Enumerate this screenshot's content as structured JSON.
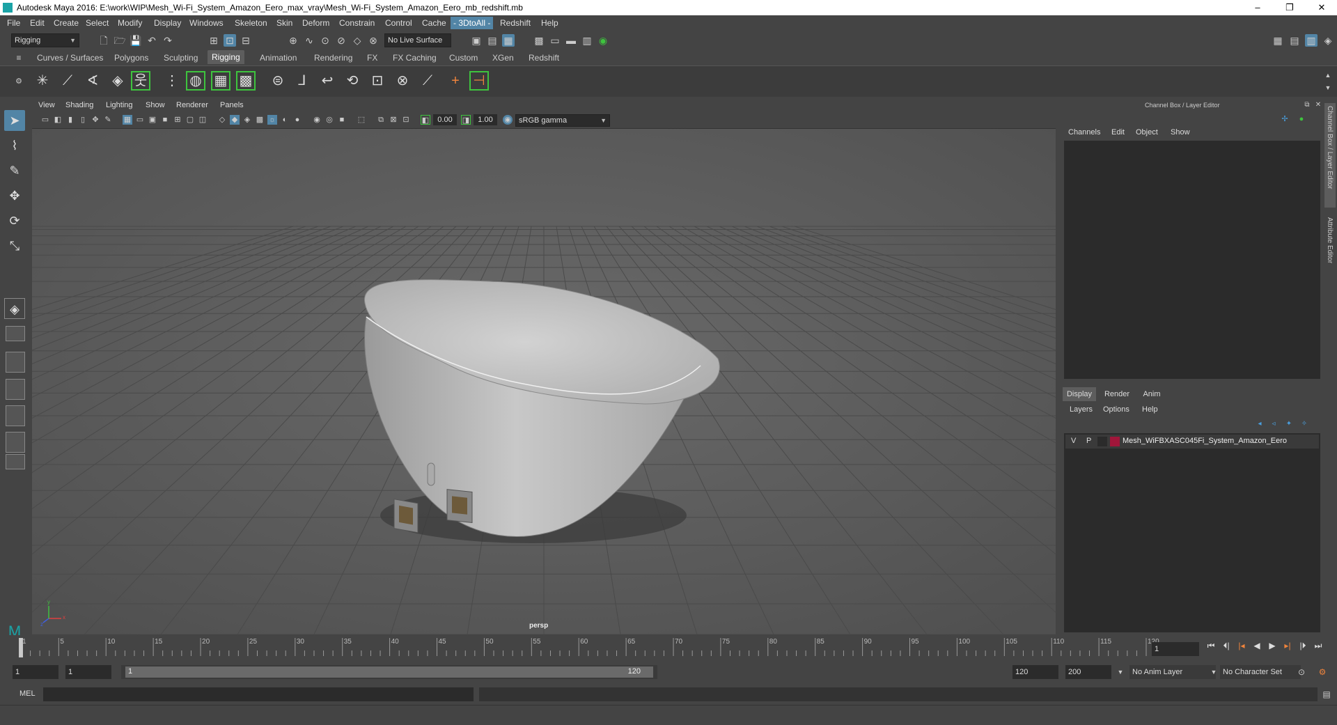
{
  "titlebar": {
    "title": "Autodesk Maya 2016: E:\\work\\WIP\\Mesh_Wi-Fi_System_Amazon_Eero_max_vray\\Mesh_Wi-Fi_System_Amazon_Eero_mb_redshift.mb",
    "minimize": "–",
    "maximize": "❐",
    "close": "✕"
  },
  "menubar": {
    "items": [
      "File",
      "Edit",
      "Create",
      "Select",
      "Modify",
      "Display",
      "Windows",
      "Skeleton",
      "Skin",
      "Deform",
      "Constrain",
      "Control",
      "Cache",
      "- 3DtoAll -",
      "Redshift",
      "Help"
    ]
  },
  "statusline": {
    "mode": "Rigging",
    "live_surface": "No Live Surface"
  },
  "shelf": {
    "tabs": [
      "Curves / Surfaces",
      "Polygons",
      "Sculpting",
      "Rigging",
      "Animation",
      "Rendering",
      "FX",
      "FX Caching",
      "Custom",
      "XGen",
      "Redshift"
    ],
    "active_tab": "Rigging"
  },
  "viewport": {
    "menu": [
      "View",
      "Shading",
      "Lighting",
      "Show",
      "Renderer",
      "Panels"
    ],
    "exposure": "0.00",
    "gamma": "1.00",
    "color_space": "sRGB gamma",
    "camera_label": "persp",
    "axis_x": "x",
    "axis_y": "y",
    "axis_z": "z"
  },
  "channel_box": {
    "title": "Channel Box / Layer Editor",
    "menu": [
      "Channels",
      "Edit",
      "Object",
      "Show"
    ]
  },
  "layer_editor": {
    "tabs": [
      "Display",
      "Render",
      "Anim"
    ],
    "active_tab": "Display",
    "menu": [
      "Layers",
      "Options",
      "Help"
    ],
    "layers": [
      {
        "v": "V",
        "p": "P",
        "name": "Mesh_WiFBXASC045Fi_System_Amazon_Eero",
        "color": "#a0163a"
      }
    ]
  },
  "sidebar": {
    "tabs": [
      "Channel Box / Layer Editor",
      "Attribute Editor"
    ]
  },
  "timeline": {
    "start": 1,
    "end": 120,
    "current_frame": "1",
    "ticks": [
      "1",
      "5",
      "10",
      "15",
      "20",
      "25",
      "30",
      "35",
      "40",
      "45",
      "50",
      "55",
      "60",
      "65",
      "70",
      "75",
      "80",
      "85",
      "90",
      "95",
      "100",
      "105",
      "110",
      "115",
      "120"
    ]
  },
  "range": {
    "anim_start": "1",
    "playback_start": "1",
    "slider_start": "1",
    "slider_end": "120",
    "playback_end": "120",
    "anim_end": "200",
    "anim_layer": "No Anim Layer",
    "character_set": "No Character Set"
  },
  "command_line": {
    "language": "MEL"
  },
  "colors": {
    "accent": "#5285a6",
    "panel_bg": "#444444",
    "viewport_bg": "#5a5a5a",
    "highlight_green": "#3ec43e"
  }
}
